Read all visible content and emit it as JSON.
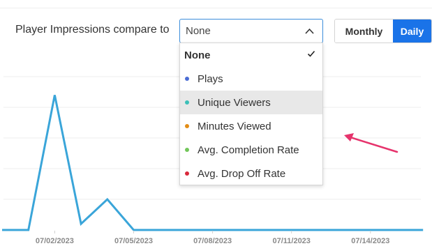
{
  "header": {
    "compare_label": "Player Impressions compare to"
  },
  "compare_select": {
    "value": "None",
    "icon": "chevron-up-icon",
    "options": [
      {
        "label": "None",
        "selected": true,
        "icon": "checkmark-icon"
      },
      {
        "label": "Plays",
        "color": "#4a6cd4"
      },
      {
        "label": "Unique Viewers",
        "color": "#3cc0b8",
        "hovered": true
      },
      {
        "label": "Minutes Viewed",
        "color": "#e38d16"
      },
      {
        "label": "Avg. Completion Rate",
        "color": "#72c65a"
      },
      {
        "label": "Avg. Drop Off Rate",
        "color": "#d9293b"
      }
    ]
  },
  "granularity": {
    "monthly_label": "Monthly",
    "daily_label": "Daily",
    "active": "Daily",
    "active_color": "#1a73e8"
  },
  "annotation": {
    "icon": "arrow-pointer-icon",
    "color": "#e6336c"
  },
  "chart_data": {
    "type": "line",
    "series_color": "#3aa5d9",
    "x_tick_labels": [
      "07/02/2023",
      "07/05/2023",
      "07/08/2023",
      "07/11/2023",
      "07/14/2023"
    ],
    "x": [
      "06/30/2023",
      "07/01/2023",
      "07/02/2023",
      "07/03/2023",
      "07/04/2023",
      "07/05/2023",
      "07/06/2023",
      "07/07/2023",
      "07/08/2023",
      "07/09/2023",
      "07/10/2023",
      "07/11/2023",
      "07/12/2023",
      "07/13/2023",
      "07/14/2023",
      "07/15/2023",
      "07/16/2023"
    ],
    "values": [
      0,
      0,
      44,
      2,
      10,
      0,
      0,
      0,
      0,
      0,
      0,
      0,
      0,
      0,
      0,
      0,
      0
    ],
    "ylim": [
      0,
      50
    ],
    "grid": true
  }
}
